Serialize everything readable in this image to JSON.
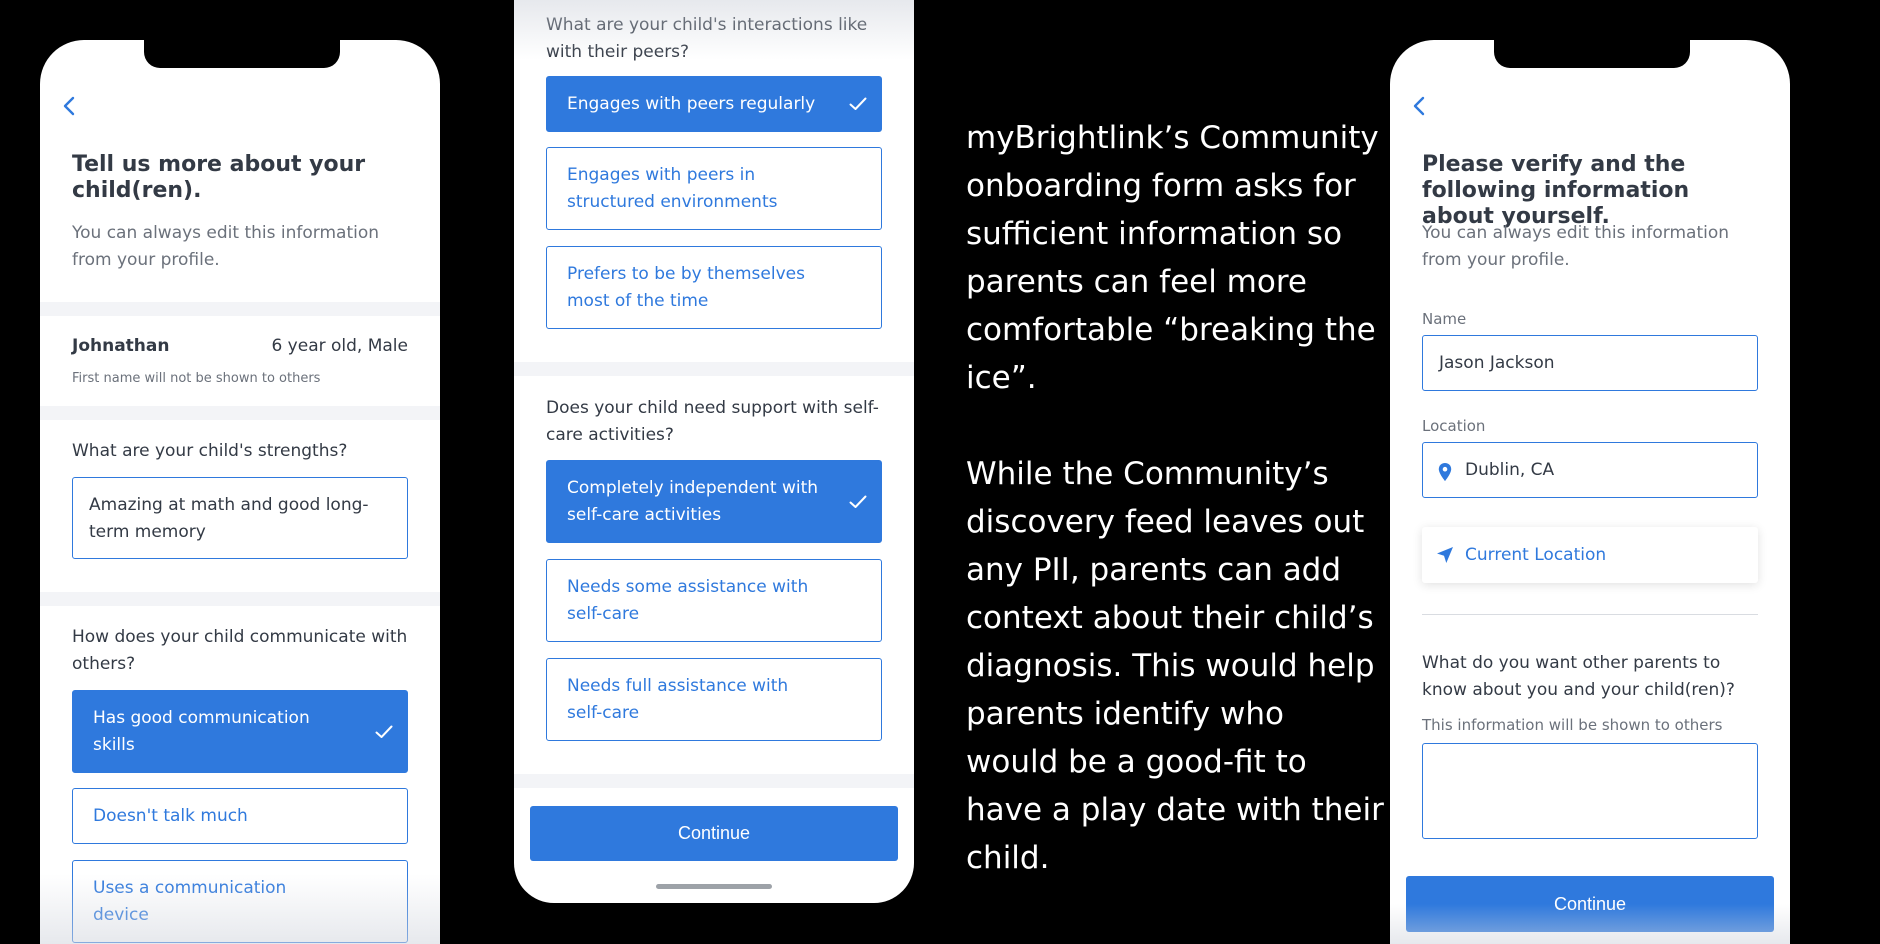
{
  "screen1": {
    "title": "Tell us more about your child(ren).",
    "subtitle": "You can always edit this information from your profile.",
    "child": {
      "name": "Johnathan",
      "info": "6 year old, Male",
      "note": "First name will not be shown to others"
    },
    "strengths": {
      "question": "What are your child's strengths?",
      "value": "Amazing at math and good long-term memory"
    },
    "communication": {
      "question": "How does your child communicate with others?",
      "options": [
        {
          "label": "Has good communication skills",
          "selected": true
        },
        {
          "label": "Doesn't talk much",
          "selected": false
        },
        {
          "label": "Uses a communication device",
          "selected": false
        }
      ]
    }
  },
  "screen2": {
    "peers": {
      "question": "What are your child's interactions like with their peers?",
      "options": [
        {
          "label": "Engages with peers regularly",
          "selected": true
        },
        {
          "label": "Engages with peers in structured environments",
          "selected": false
        },
        {
          "label": "Prefers to be by themselves most of the time",
          "selected": false
        }
      ]
    },
    "selfcare": {
      "question": "Does your child need support with self-care activities?",
      "options": [
        {
          "label": "Completely independent with self-care activities",
          "selected": true
        },
        {
          "label": "Needs some assistance with self-care",
          "selected": false
        },
        {
          "label": "Needs full assistance with self-care",
          "selected": false
        }
      ]
    },
    "continue_label": "Continue"
  },
  "caption": {
    "paragraph1": "myBrightlink’s Community onboarding form asks for sufficient information so parents can feel more comfortable “breaking the ice”.",
    "paragraph2": "While the Community’s discovery feed leaves out any PII, parents can add context about their child’s diagnosis. This would help parents identify who would be a good-fit to have a play date with their child."
  },
  "screen4": {
    "title": "Please verify and the following information about yourself.",
    "subtitle": "You can always edit this information from your profile.",
    "name_label": "Name",
    "name_value": "Jason Jackson",
    "location_label": "Location",
    "location_value": "Dublin, CA",
    "current_location_label": "Current Location",
    "about_question": "What do you want other parents to know about you and your child(ren)?",
    "about_note": "This information will be shown to others",
    "about_value": "",
    "continue_label": "Continue"
  },
  "colors": {
    "accent": "#2f79dd",
    "text": "#333a45",
    "muted": "#6b717b",
    "background": "#000000"
  },
  "icons": [
    "back-chevron-icon",
    "checkmark-icon",
    "location-pin-icon",
    "navigation-arrow-icon"
  ]
}
